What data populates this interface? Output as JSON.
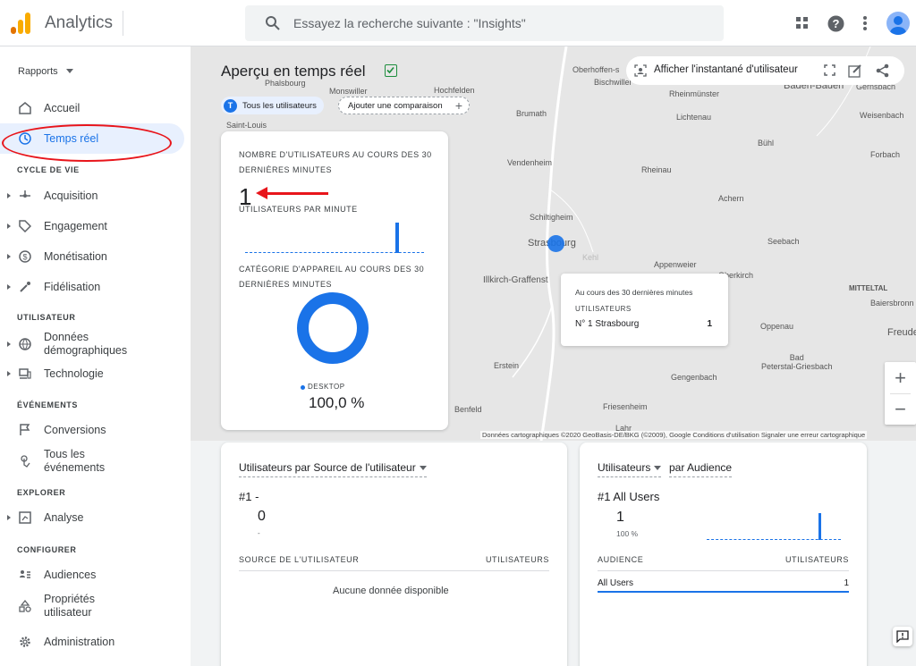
{
  "header": {
    "app_title": "Analytics",
    "search_placeholder": "Essayez la recherche suivante : \"Insights\""
  },
  "sidebar": {
    "reports_label": "Rapports",
    "home_label": "Accueil",
    "realtime_label": "Temps réel",
    "sections": {
      "lifecycle": "CYCLE DE VIE",
      "user": "UTILISATEUR",
      "events": "ÉVÉNEMENTS",
      "explore": "EXPLORER",
      "configure": "CONFIGURER"
    },
    "lifecycle_items": [
      "Acquisition",
      "Engagement",
      "Monétisation",
      "Fidélisation"
    ],
    "user_items": [
      "Données\ndémographiques",
      "Technologie"
    ],
    "event_items": [
      "Conversions",
      "Tous les\névénements"
    ],
    "explore_items": [
      "Analyse"
    ],
    "configure_items": [
      "Audiences",
      "Propriétés\nutilisateur"
    ],
    "admin_label": "Administration"
  },
  "main": {
    "title": "Aperçu en temps réel",
    "chip_all_badge": "T",
    "chip_all_label": "Tous les utilisateurs",
    "chip_add_label": "Ajouter une comparaison",
    "snapshot_label": "Afficher l'instantané d'utilisateur"
  },
  "overview": {
    "users_heading": "NOMBRE D'UTILISATEURS AU COURS DES 30 DERNIÈRES MINUTES",
    "users_value": "1",
    "per_minute_heading": "UTILISATEURS PAR MINUTE",
    "device_heading": "CATÉGORIE D'APPAREIL AU COURS DES 30 DERNIÈRES MINUTES",
    "device_legend": "DESKTOP",
    "device_value": "100,0 %"
  },
  "tooltip": {
    "period": "Au cours des 30 dernières minutes",
    "metric": "UTILISATEURS",
    "city": "N° 1 Strasbourg",
    "value": "1"
  },
  "map": {
    "labels": [
      "Phalsbourg",
      "Monswiller",
      "Hochfelden",
      "Saint-Louis",
      "Brumath",
      "Oberhoffen-s",
      "Bischwiller",
      "Rheinmünster",
      "Lichtenau",
      "Vendenheim",
      "Rheinau",
      "Schiltigheim",
      "Strasbourg",
      "Illkirch-Graffenst",
      "Appenweier",
      "Kehl",
      "Erstein",
      "Gengenbach",
      "Benfeld",
      "Friesenheim",
      "Achern",
      "Bühl",
      "Seebach",
      "Oppenau",
      "Bad\nPeterstal-Griesbach",
      "Forbach",
      "Weisenbach",
      "Baden-Baden",
      "Gernsbach",
      "Baiersbronn",
      "Freude",
      "Oberkirch",
      "Lahr"
    ],
    "mitteltal": "MITTELTAL",
    "footer": "Données cartographiques ©2020 GeoBasis-DE/BKG (©2009), Google   Conditions d'utilisation   Signaler une erreur cartographique"
  },
  "source_card": {
    "selector": "Utilisateurs par Source de l'utilisateur",
    "rank": "#1  -",
    "value": "0",
    "sub": "-",
    "col_source": "SOURCE DE L'UTILISATEUR",
    "col_users": "UTILISATEURS",
    "empty": "Aucune donnée disponible"
  },
  "audience_card": {
    "selector_a": "Utilisateurs",
    "selector_b": "par Audience",
    "rank": "#1  All Users",
    "value": "1",
    "pct": "100 %",
    "col_audience": "AUDIENCE",
    "col_users": "UTILISATEURS",
    "row_label": "All Users",
    "row_value": "1"
  }
}
